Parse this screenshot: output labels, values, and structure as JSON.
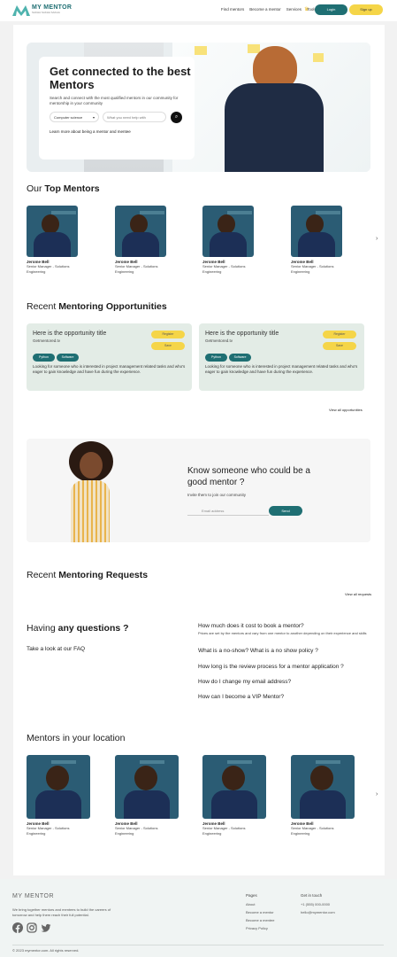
{
  "header": {
    "logo_title": "MY MENTOR",
    "logo_sub": "SAKHA SAKHA SAKHA",
    "nav": [
      "Find mentors",
      "Become a mentor",
      "Services",
      "Tools"
    ],
    "login_label": "Login",
    "signup_label": "Sign up"
  },
  "hero": {
    "title": "Get connected to the best Mentors",
    "description": "Search and connect with the most qualified mentors in our community for mentorship in your community",
    "select_value": "Computer science",
    "search_placeholder": "What you need help with",
    "link": "Learn more about being a mentor and mentee"
  },
  "top_mentors": {
    "title_plain": "Our ",
    "title_bold": "Top Mentors",
    "items": [
      {
        "name": "Jerome Bell",
        "role": "Senior Manager - Solutions Engineering"
      },
      {
        "name": "Jerome Bell",
        "role": "Senior Manager - Solutions Engineering"
      },
      {
        "name": "Jerome Bell",
        "role": "Senior Manager - Solutions Engineering"
      },
      {
        "name": "Jerome Bell",
        "role": "Senior Manager - Solutions Engineering"
      }
    ],
    "next_arrow": "›"
  },
  "opportunities": {
    "title_plain": "Recent ",
    "title_bold": "Mentoring Opportunities",
    "items": [
      {
        "title": "Here is the opportunity title",
        "sub": "Getmentored.tv",
        "tag1": "Register",
        "tag2": "Save",
        "pill1": "Python",
        "pill2": "Software",
        "desc": "Looking for someone who is interested in project management related tasks and who's eager to gain knowledge and have fun during the experience."
      },
      {
        "title": "Here is the opportunity title",
        "sub": "Getmentored.tv",
        "tag1": "Register",
        "tag2": "Save",
        "pill1": "Python",
        "pill2": "Software",
        "desc": "Looking for someone who is interested in project management related tasks and who's eager to gain knowledge and have fun during the experience."
      }
    ],
    "view_all": "View all opportunities"
  },
  "know": {
    "title": "Know someone who could be a good mentor ?",
    "sub": "Invite them to join our community",
    "input_placeholder": "Email address",
    "send_label": "Send"
  },
  "requests": {
    "title_plain": "Recent ",
    "title_bold": "Mentoring Requests",
    "view_all": "View all requests"
  },
  "faq": {
    "title_plain": "Having ",
    "title_bold": "any questions ?",
    "sub": "Take a look at our FAQ",
    "q1": "How much does it cost to book a mentor?",
    "a1": "Prices are set by the mentors and vary from one mentor to another depending on their experience and skills",
    "q2": "What is a no-show? What is a no show policy ?",
    "q3": "How long is the review process for a mentor application ?",
    "q4": "How do I change my email address?",
    "q5": "How can I become a VIP Mentor?"
  },
  "location": {
    "title_plain": "Mentors in your location",
    "items": [
      {
        "name": "Jerome Bell",
        "role": "Senior Manager - Solutions Engineering"
      },
      {
        "name": "Jerome Bell",
        "role": "Senior Manager - Solutions Engineering"
      },
      {
        "name": "Jerome Bell",
        "role": "Senior Manager - Solutions Engineering"
      },
      {
        "name": "Jerome Bell",
        "role": "Senior Manager - Solutions Engineering"
      }
    ],
    "next_arrow": "›"
  },
  "footer": {
    "brand": "MY MENTOR",
    "desc": "We bring together mentors and mentees to build the careers of tomorrow and help them reach their full potential.",
    "pages_title": "Pages",
    "pages": [
      "About",
      "Become a mentor",
      "Become a mentee",
      "Privacy Policy"
    ],
    "contact_title": "Get in touch",
    "phone": "+1 (555) 000-0000",
    "email": "hello@mymentor.com",
    "copyright": "© 2023 mymentor.com. All rights reserved."
  },
  "colors": {
    "accent": "#1f6f73",
    "yellow": "#f5d548",
    "card_green": "#e3ece6"
  }
}
